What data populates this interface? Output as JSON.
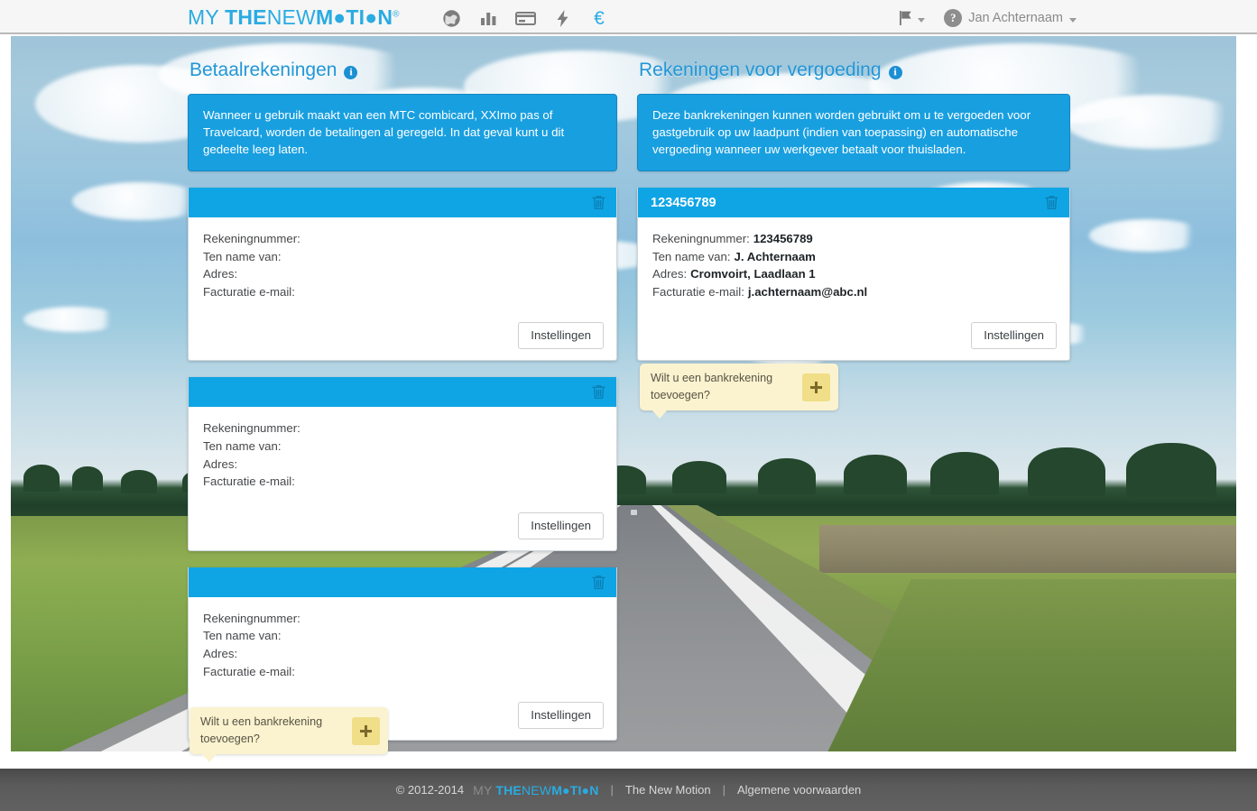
{
  "header": {
    "brand": {
      "my": "MY ",
      "the": "THE",
      "new": "NEW",
      "motion": "M●TI●N",
      "reg": "®"
    },
    "nav_icons": [
      {
        "name": "globe-icon",
        "label": "Globe"
      },
      {
        "name": "bar-chart-icon",
        "label": "Statistieken"
      },
      {
        "name": "credit-card-icon",
        "label": "Kaarten"
      },
      {
        "name": "lightning-bolt-icon",
        "label": "Laden"
      },
      {
        "name": "euro-icon",
        "label": "Betalingen"
      }
    ],
    "flag_label": "",
    "user_name": "Jan Achternaam"
  },
  "left_column": {
    "title": "Betaalrekeningen",
    "info_icon": "i",
    "notice": "Wanneer u gebruik maakt van een MTC combicard, XXImo pas of Travelcard, worden de betalingen al geregeld. In dat geval kunt u dit gedeelte leeg laten.",
    "cards": [
      {
        "header_title": "",
        "labels": {
          "account_number": "Rekeningnummer:",
          "account_holder": "Ten name van:",
          "address": "Adres:",
          "billing_email": "Facturatie e-mail:"
        },
        "values": {
          "account_number": "",
          "account_holder": "",
          "address": "",
          "billing_email": ""
        },
        "settings_label": "Instellingen"
      },
      {
        "header_title": "",
        "labels": {
          "account_number": "Rekeningnummer:",
          "account_holder": "Ten name van:",
          "address": "Adres:",
          "billing_email": "Facturatie e-mail:"
        },
        "values": {
          "account_number": "",
          "account_holder": "",
          "address": "",
          "billing_email": ""
        },
        "settings_label": "Instellingen"
      },
      {
        "header_title": "",
        "labels": {
          "account_number": "Rekeningnummer:",
          "account_holder": "Ten name van:",
          "address": "Adres:",
          "billing_email": "Facturatie e-mail:"
        },
        "values": {
          "account_number": "",
          "account_holder": "",
          "address": "",
          "billing_email": ""
        },
        "settings_label": "Instellingen"
      }
    ],
    "add_box": {
      "text": "Wilt u een bankrekening toevoegen?",
      "plus_label": "+"
    }
  },
  "right_column": {
    "title": "Rekeningen voor vergoeding",
    "info_icon": "i",
    "notice": "Deze bankrekeningen kunnen worden gebruikt om u te vergoeden voor gastgebruik op uw laadpunt (indien van toepassing) en automatische vergoeding wanneer uw werkgever betaalt voor thuisladen.",
    "cards": [
      {
        "header_title": "123456789",
        "labels": {
          "account_number": "Rekeningnummer:",
          "account_holder": "Ten name van:",
          "address": "Adres:",
          "billing_email": "Facturatie e-mail:"
        },
        "values": {
          "account_number": "123456789",
          "account_holder": "J. Achternaam",
          "address": "Cromvoirt, Laadlaan 1",
          "billing_email": "j.achternaam@abc.nl"
        },
        "settings_label": "Instellingen"
      }
    ],
    "add_box": {
      "text": "Wilt u een bankrekening toevoegen?",
      "plus_label": "+"
    }
  },
  "footer": {
    "copyright": "© 2012-2014",
    "brand": {
      "my": "MY ",
      "the": "THE",
      "new": "NEW",
      "motion": "M●TI●N"
    },
    "sep": "|",
    "link_company": "The New Motion",
    "link_terms": "Algemene voorwaarden"
  },
  "colors": {
    "brand_blue": "#2aabe2",
    "card_header_blue": "#0fa5e5",
    "notice_blue": "#189fe0",
    "title_blue": "#2196d6",
    "tooltip_yellow": "#fbf3cf",
    "plus_yellow": "#f0de88",
    "footer_gray": "#5b5b5b"
  }
}
